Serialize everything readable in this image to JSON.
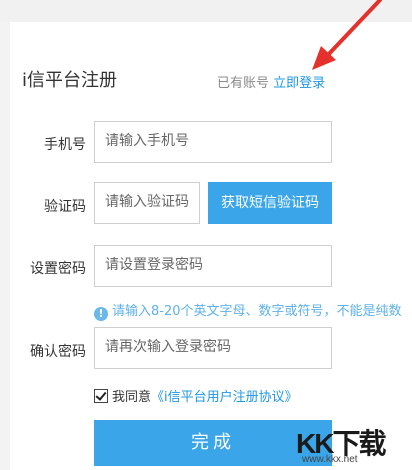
{
  "header": {
    "title": "i信平台注册",
    "login_prompt": "已有账号",
    "login_link": "立即登录"
  },
  "form": {
    "phone": {
      "label": "手机号",
      "placeholder": "请输入手机号"
    },
    "code": {
      "label": "验证码",
      "placeholder": "请输入验证码",
      "button": "获取短信验证码"
    },
    "password": {
      "label": "设置密码",
      "placeholder": "请设置登录密码"
    },
    "password_hint": "请输入8-20个英文字母、数字或符号，不能是纯数",
    "confirm": {
      "label": "确认密码",
      "placeholder": "请再次输入登录密码"
    },
    "agree_text": "我同意",
    "agree_link": "《i信平台用户注册协议》",
    "submit": "完成"
  },
  "watermark": {
    "logo": "KK下载",
    "url": "www.kkx.net"
  },
  "colors": {
    "accent": "#3aa5e9",
    "link": "#1e98e0",
    "arrow": "#e5312c"
  }
}
